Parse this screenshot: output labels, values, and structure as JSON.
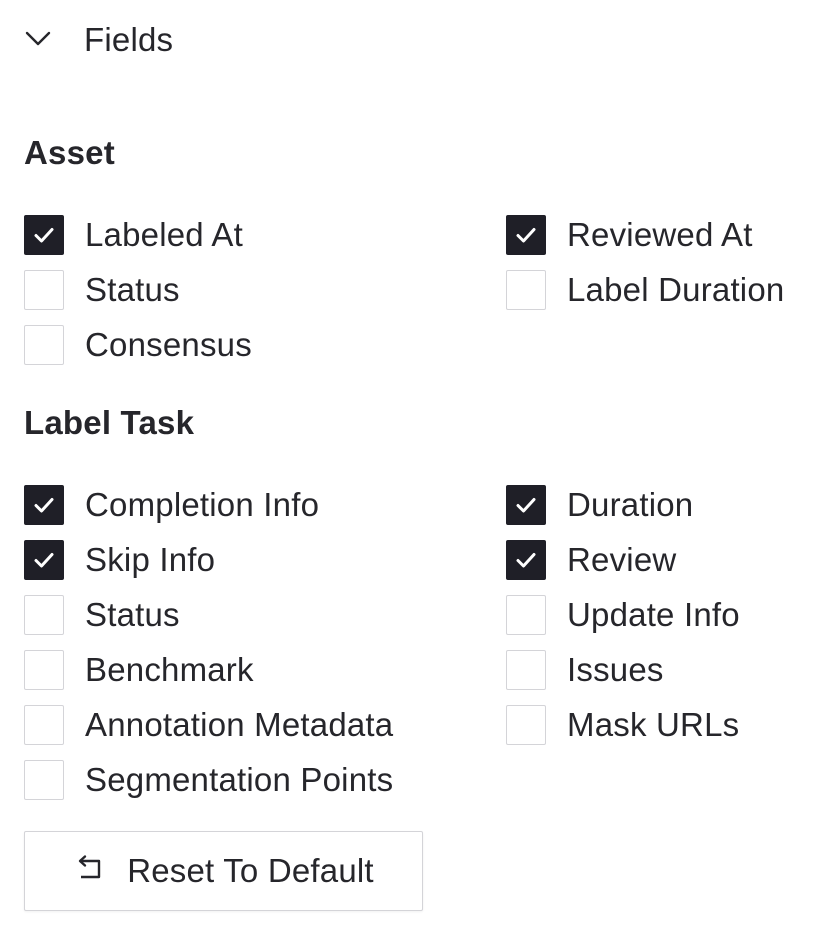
{
  "fields": {
    "toggle_label": "Fields",
    "toggle_icon": "chevron-down-icon"
  },
  "asset": {
    "title": "Asset",
    "left": [
      {
        "label": "Labeled At",
        "checked": true
      },
      {
        "label": "Status",
        "checked": false
      },
      {
        "label": "Consensus",
        "checked": false
      }
    ],
    "right": [
      {
        "label": "Reviewed At",
        "checked": true
      },
      {
        "label": "Label Duration",
        "checked": false
      }
    ]
  },
  "label_task": {
    "title": "Label Task",
    "left": [
      {
        "label": "Completion Info",
        "checked": true
      },
      {
        "label": "Skip Info",
        "checked": true
      },
      {
        "label": "Status",
        "checked": false
      },
      {
        "label": "Benchmark",
        "checked": false
      },
      {
        "label": "Annotation Metadata",
        "checked": false
      },
      {
        "label": "Segmentation Points",
        "checked": false
      }
    ],
    "right": [
      {
        "label": "Duration",
        "checked": true
      },
      {
        "label": "Review",
        "checked": true
      },
      {
        "label": "Update Info",
        "checked": false
      },
      {
        "label": "Issues",
        "checked": false
      },
      {
        "label": "Mask URLs",
        "checked": false
      }
    ]
  },
  "reset": {
    "label": "Reset To Default",
    "icon": "reset-icon"
  },
  "colors": {
    "checked_fill": "#1f1f27",
    "border": "#d4d4d8",
    "text": "#26262b"
  }
}
